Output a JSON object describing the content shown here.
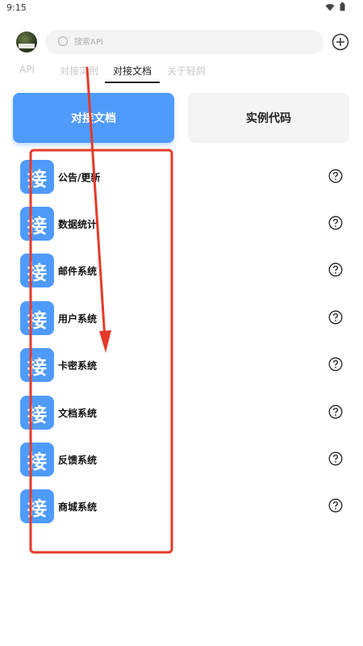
{
  "status_bar": {
    "time": "9:15",
    "icons": [
      "wifi-icon",
      "battery-icon"
    ]
  },
  "header": {
    "avatar_icon": "avatar-image",
    "search": {
      "placeholder": "搜索API",
      "value": ""
    },
    "add_icon": "plus-circle-icon"
  },
  "tabs": [
    {
      "label": "API",
      "active": false
    },
    {
      "label": "对接实例",
      "active": false
    },
    {
      "label": "对接文档",
      "active": true
    },
    {
      "label": "关于轻鸽",
      "active": false
    }
  ],
  "segments": {
    "docs_label": "对接文档",
    "code_label": "实例代码",
    "active": "docs"
  },
  "list": {
    "badge_text": "接",
    "items": [
      {
        "label": "公告/更新"
      },
      {
        "label": "数据统计"
      },
      {
        "label": "邮件系统"
      },
      {
        "label": "用户系统"
      },
      {
        "label": "卡密系统"
      },
      {
        "label": "文档系统"
      },
      {
        "label": "反馈系统"
      },
      {
        "label": "商城系统"
      }
    ]
  },
  "colors": {
    "accent": "#4f9bfb",
    "annotation": "#e53a2a",
    "inactive_tab": "#c8c8c8"
  }
}
